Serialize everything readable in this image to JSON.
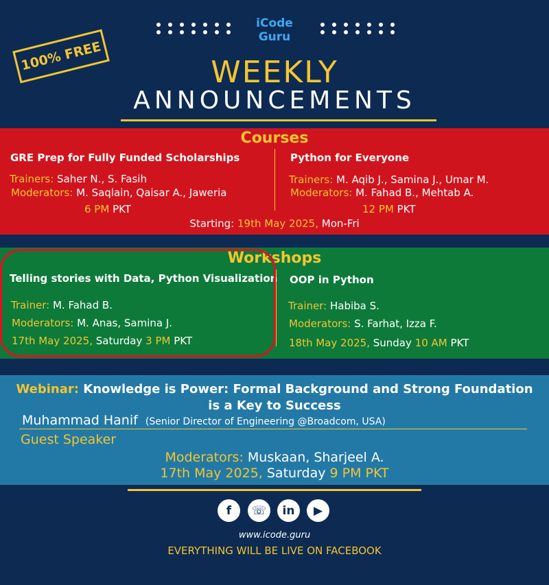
{
  "brand": {
    "line1": "iCode",
    "line2": "Guru"
  },
  "stamp": "100% FREE",
  "header": {
    "title1": "WEEKLY",
    "title2": "ANNOUNCEMENTS"
  },
  "courses": {
    "title": "Courses",
    "left": {
      "name": "GRE Prep for Fully Funded Scholarships",
      "trainers_label": "Trainers:",
      "trainers": "Saher N., S. Fasih",
      "moderators_label": "Moderators:",
      "moderators": "M. Saqlain, Qaisar A., Jaweria",
      "time": "6 PM",
      "tz": "PKT"
    },
    "right": {
      "name": "Python for Everyone",
      "trainers_label": "Trainers:",
      "trainers": "M. Aqib J., Samina J., Umar M.",
      "moderators_label": "Moderators:",
      "moderators": "M. Fahad B., Mehtab A.",
      "time": "12 PM",
      "tz": "PKT"
    },
    "starting_label": "Starting:",
    "starting_date": "19th May 2025,",
    "starting_days": "Mon-Fri"
  },
  "workshops": {
    "title": "Workshops",
    "left": {
      "name": "Telling stories with Data, Python Visualization",
      "trainer_label": "Trainer:",
      "trainer": "M. Fahad B.",
      "moderators_label": "Moderators:",
      "moderators": "M. Anas, Samina J.",
      "date": "17th May 2025,",
      "day": "Saturday",
      "time": "3 PM",
      "tz": "PKT"
    },
    "right": {
      "name": "OOP in Python",
      "trainer_label": "Trainer:",
      "trainer": "Habiba S.",
      "moderators_label": "Moderators:",
      "moderators": "S. Farhat, Izza F.",
      "date": "18th May 2025,",
      "day": "Sunday",
      "time": "10 AM",
      "tz": "PKT"
    }
  },
  "webinar": {
    "label": "Webinar:",
    "title_line1": "Knowledge is Power: Formal Background and Strong Foundation",
    "title_line2": "is a Key to Success",
    "speaker": "Muhammad Hanif",
    "speaker_title": "(Senior Director of Engineering @Broadcom, USA)",
    "guest_label": "Guest Speaker",
    "moderators_label": "Moderators:",
    "moderators": "Muskaan, Sharjeel A.",
    "date": "17th May 2025,",
    "day": "Saturday",
    "time": "9 PM PKT"
  },
  "footer": {
    "socials": [
      "f",
      "☏",
      "in",
      "▶"
    ],
    "social_icons": [
      "facebook-icon",
      "whatsapp-icon",
      "linkedin-icon",
      "youtube-icon"
    ],
    "website": "www.icode.guru",
    "note": "EVERYTHING WILL BE LIVE ON FACEBOOK"
  },
  "colors": {
    "navy": "#0d2a52",
    "red": "#d0141e",
    "green": "#0e7a3a",
    "blue": "#2379a6",
    "yellow": "#f3c531",
    "brand_blue": "#3fa9f5"
  }
}
